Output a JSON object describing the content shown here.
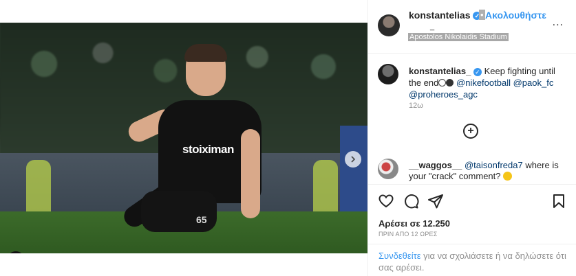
{
  "post": {
    "author": "konstantelias",
    "follow_label": "Ακολουθήστε",
    "dot_sep": "•",
    "header_extra": "_",
    "location": "Apostolos Nikolaidis Stadium",
    "more_label": "...",
    "caption": {
      "username": "konstantelias_",
      "text_part1": "Keep fighting until the end",
      "mention1": "@nikefootball",
      "mention2": "@paok_fc",
      "mention3": "@proheroes_agc",
      "time": "12ω"
    },
    "comment": {
      "username": "__waggos__",
      "mention": "@taisonfreda7",
      "text": "where is your \"crack\" comment?"
    },
    "likes": "Αρέσει σε 12.250",
    "posted_ago": "ΠΡΙΝ ΑΠΟ 12 ΩΡΕΣ",
    "login_link": "Συνδεθείτε",
    "login_text": "για να σχολιάσετε ή να δηλώσετε ότι σας αρέσει.",
    "photo": {
      "sponsor": "stoiximan",
      "shirt_number": "65",
      "carousel_active_index": 1,
      "carousel_count": 2
    }
  },
  "icons": [
    "verified-icon",
    "more-icon",
    "next-arrow-icon",
    "tag-user-icon",
    "add-circle-icon",
    "heart-icon",
    "comment-icon",
    "share-icon",
    "bookmark-icon",
    "laughing-emoji-icon",
    "football-icon"
  ],
  "colors": {
    "accent": "#3897f0",
    "mention": "#00376b",
    "muted": "#8e8e8e",
    "text": "#262626"
  }
}
